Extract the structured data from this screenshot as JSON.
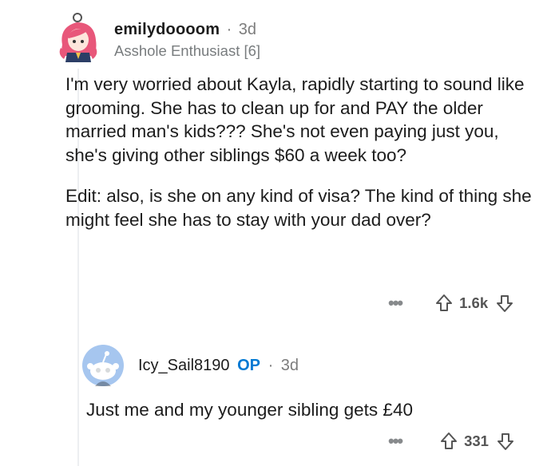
{
  "comment": {
    "author": "emilydoooom",
    "separator": "·",
    "age": "3d",
    "flair": "Asshole Enthusiast [6]",
    "paragraphs": [
      "I'm very worried about Kayla, rapidly starting to sound like grooming. She has to clean up for and PAY the older married man's kids??? She's not even paying just you, she's giving other siblings $60 a week too?",
      "Edit: also, is she on any kind of visa? The kind of thing she might feel she has to stay with your dad over?"
    ],
    "more_label": "•••",
    "votes": "1.6k",
    "icons": {
      "upvote": "upvote-arrow-icon",
      "downvote": "downvote-arrow-icon",
      "more": "more-dots-icon"
    }
  },
  "reply": {
    "author": "Icy_Sail8190",
    "op_badge": "OP",
    "separator": "·",
    "age": "3d",
    "text": "Just me and my younger sibling gets £40",
    "more_label": "•••",
    "votes": "331"
  },
  "colors": {
    "op_blue": "#0079d3",
    "avatar_blue_bg": "#a6c6ef",
    "avatar_pink_hair": "#e8577a",
    "thread_line": "#edeff1"
  }
}
